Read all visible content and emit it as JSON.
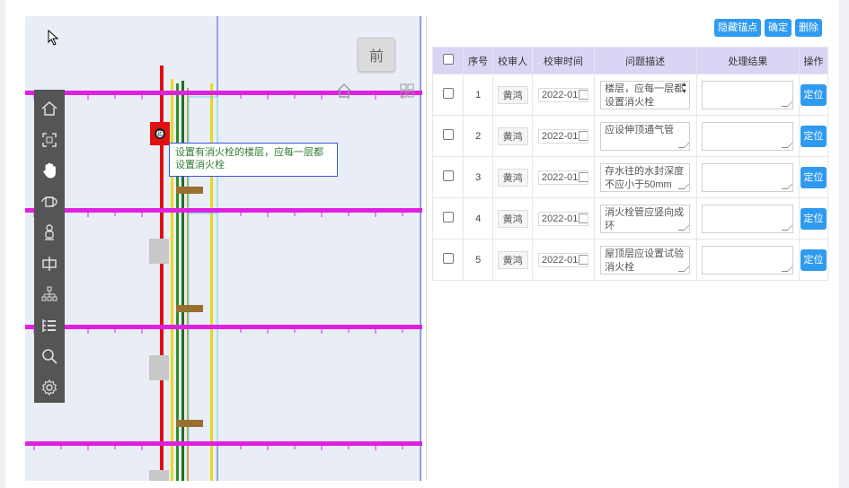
{
  "viewer": {
    "view_label": "前",
    "tooltip_text": "设置有消火栓的楼层，应每一层都设置消火栓",
    "marker_glyph": "㊣",
    "toolbar_icons": [
      "home-icon",
      "frame-icon",
      "hand-icon",
      "orbit-icon",
      "person-icon",
      "center-icon",
      "structure-tree-icon",
      "list-tree-icon",
      "search-icon",
      "settings-icon"
    ]
  },
  "panel": {
    "buttons": {
      "hide_anchors": "隐藏锚点",
      "confirm": "确定",
      "delete": "删除"
    },
    "columns": {
      "index": "序号",
      "reviewer": "校审人",
      "review_time": "校审时间",
      "issue": "问题描述",
      "result": "处理结果",
      "action": "操作"
    },
    "rows": [
      {
        "index": "1",
        "reviewer": "黄鸿",
        "time": "2022-01",
        "issue": "楼层，应每一层都设置消火栓",
        "result": "",
        "action": "定位"
      },
      {
        "index": "2",
        "reviewer": "黄鸿",
        "time": "2022-01",
        "issue": "应设伸顶通气管",
        "result": "",
        "action": "定位"
      },
      {
        "index": "3",
        "reviewer": "黄鸿",
        "time": "2022-01",
        "issue": "存水往的水封深度不应小于50mm",
        "result": "",
        "action": "定位"
      },
      {
        "index": "4",
        "reviewer": "黄鸿",
        "time": "2022-01",
        "issue": "消火栓管应竖向成环",
        "result": "",
        "action": "定位"
      },
      {
        "index": "5",
        "reviewer": "黄鸿",
        "time": "2022-01",
        "issue": "屋顶层应设置试验消火栓",
        "result": "",
        "action": "定位"
      }
    ]
  },
  "colors": {
    "accent": "#2f9bf0",
    "header_bg": "#d9d6f5",
    "pipe_magenta": "#e020e0",
    "pipe_red": "#e01010"
  }
}
